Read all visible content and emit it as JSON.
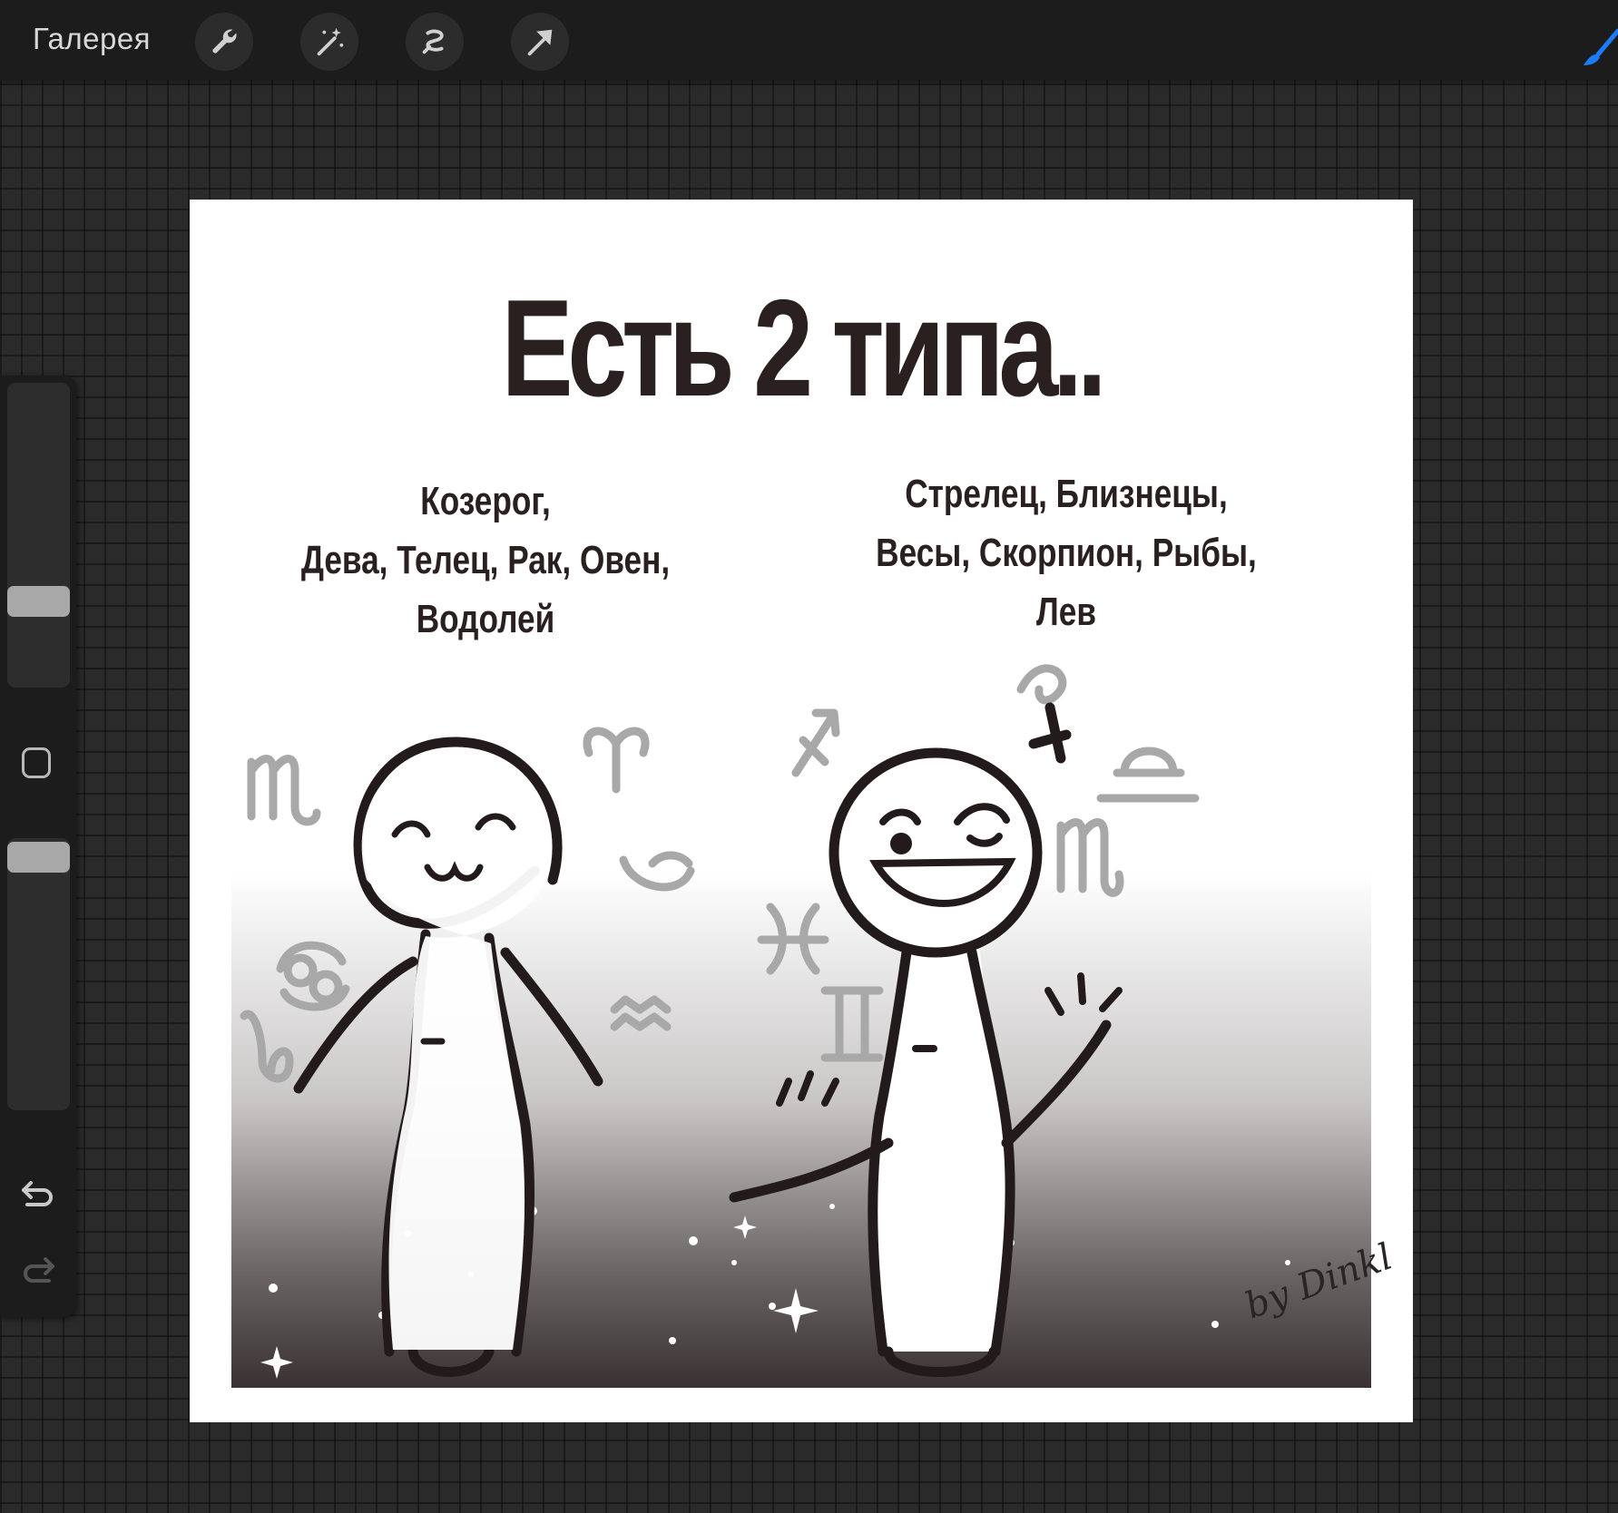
{
  "toolbar": {
    "gallery_label": "Галерея",
    "tools": [
      {
        "name": "actions",
        "icon": "wrench-icon"
      },
      {
        "name": "adjustments",
        "icon": "magic-wand-icon"
      },
      {
        "name": "selection",
        "icon": "selection-icon"
      },
      {
        "name": "transform",
        "icon": "arrow-icon"
      }
    ],
    "active_tool_icon": "brush-icon",
    "accent_color": "#1a7cff"
  },
  "sidebar": {
    "brush_size_level": 0.62,
    "opacity_level": 0.92,
    "icons": [
      "modify-square-icon",
      "undo-icon",
      "redo-icon"
    ]
  },
  "artwork": {
    "title": "Есть 2 типа..",
    "left_group": [
      "Козерог,",
      "Дева, Телец, Рак, Овен,",
      "Водолей"
    ],
    "right_group": [
      "Стрелец, Близнецы,",
      "Весы, Скорпион, Рыбы,",
      "Лев"
    ],
    "signature": "by Dinkl"
  }
}
